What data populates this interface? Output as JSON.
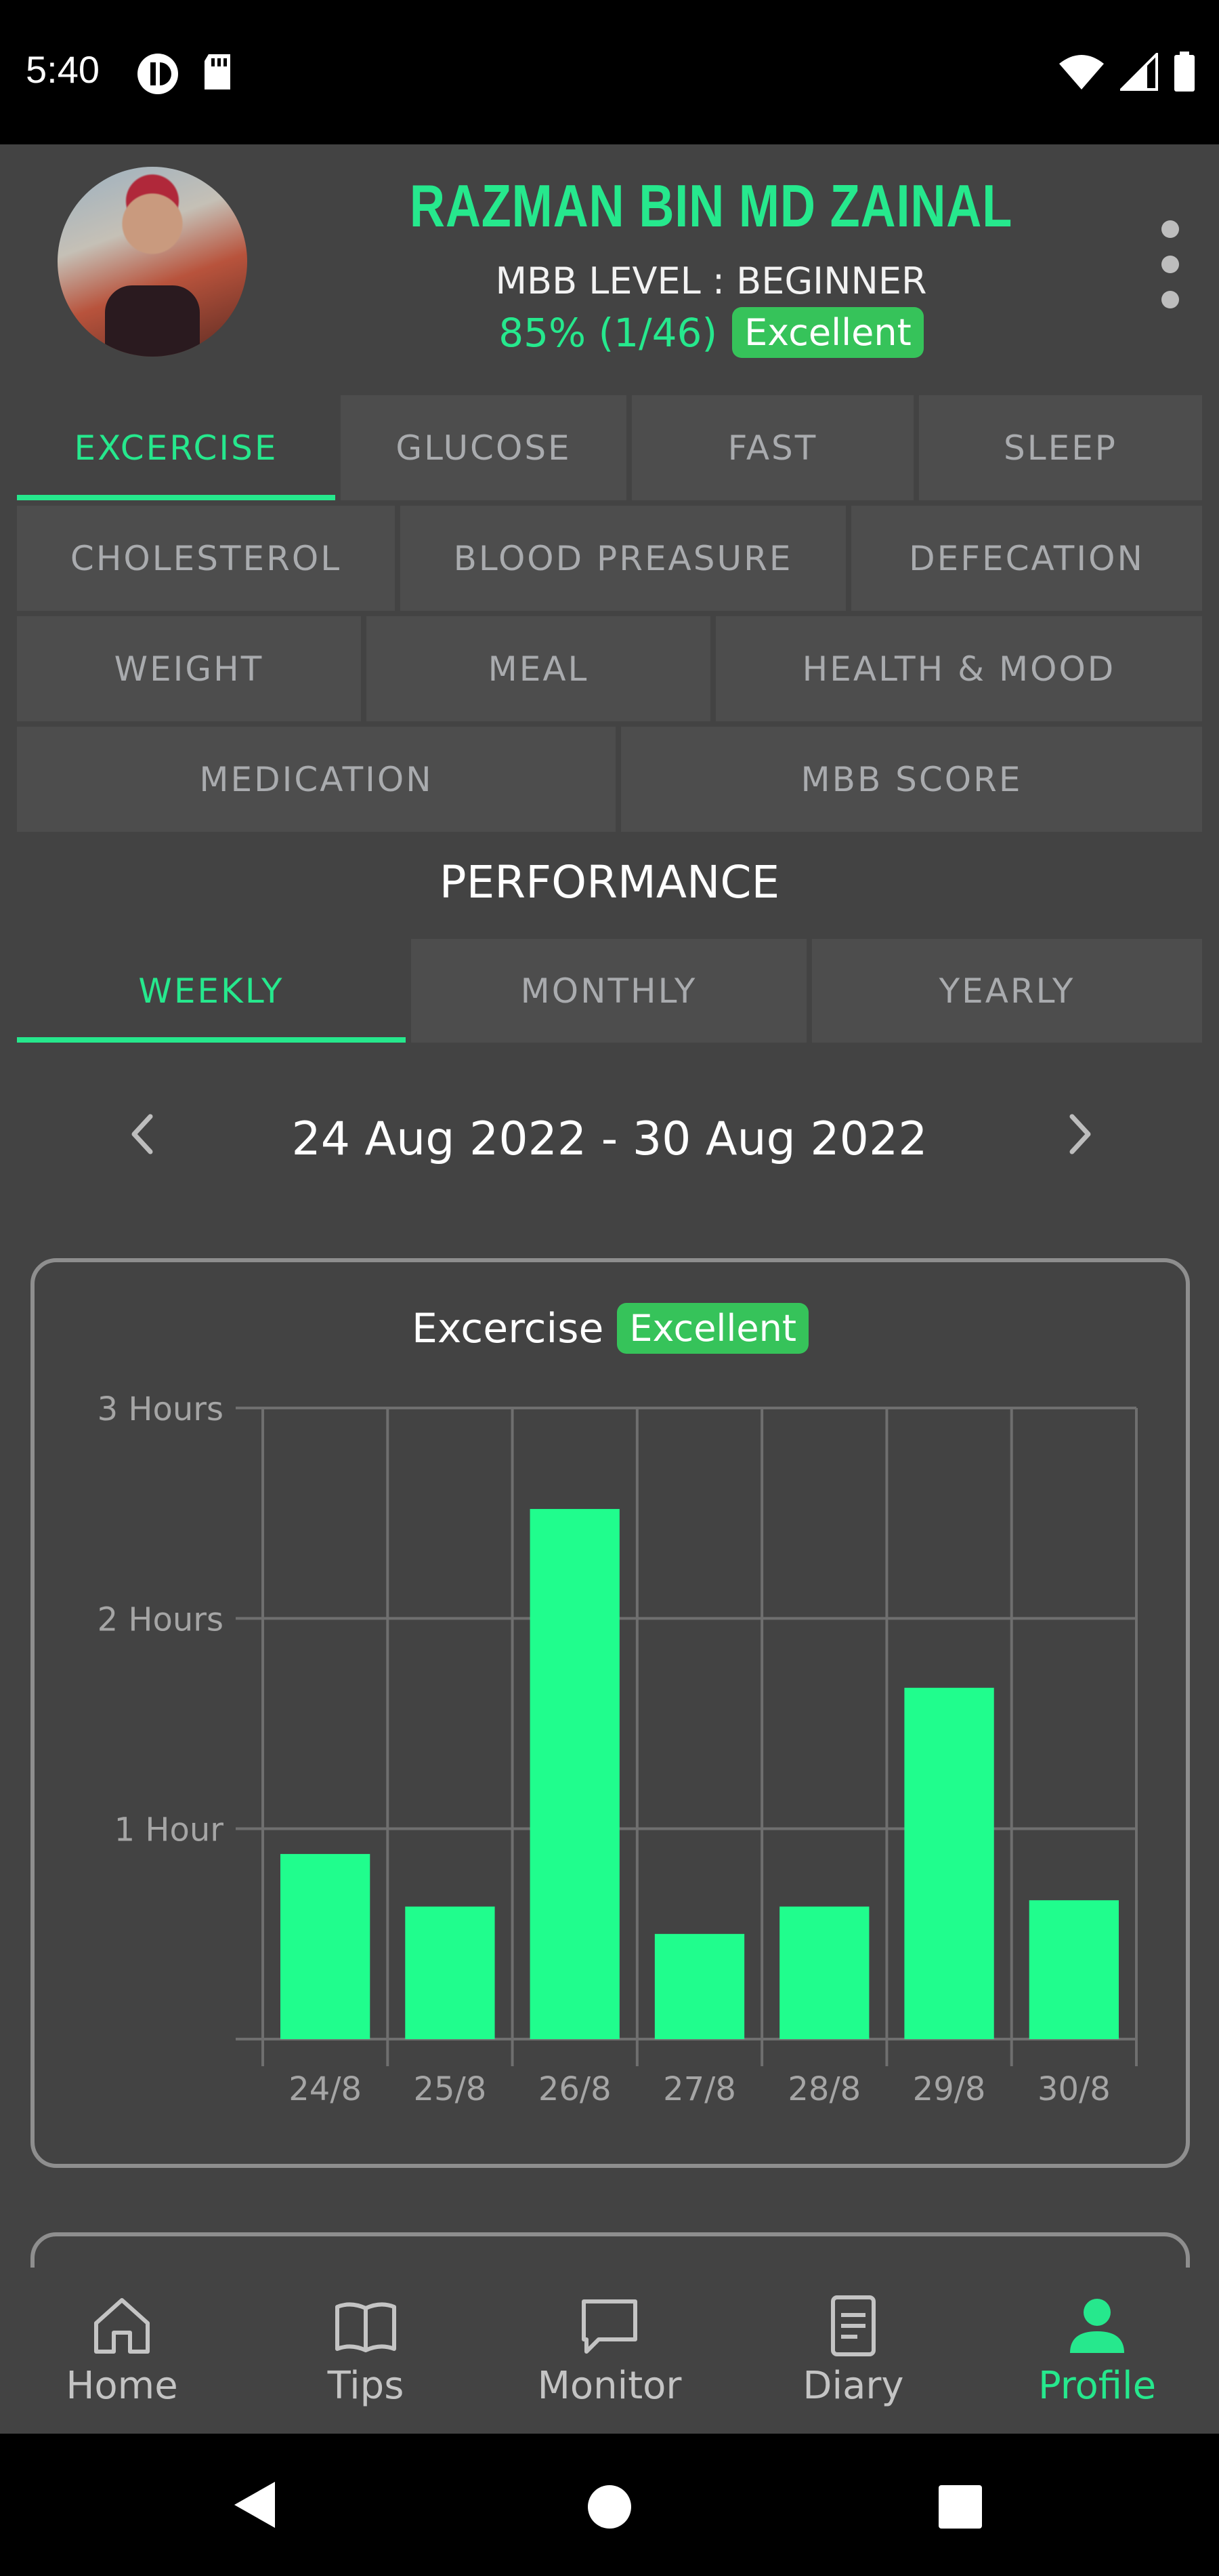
{
  "status_bar": {
    "time": "5:40"
  },
  "profile": {
    "name": "RAZMAN BIN MD ZAINAL",
    "mbb_level": "MBB LEVEL : BEGINNER",
    "score": "85% (1/46)",
    "score_badge": "Excellent"
  },
  "categories": {
    "row1": [
      "EXCERCISE",
      "GLUCOSE",
      "FAST",
      "SLEEP"
    ],
    "row2": [
      "CHOLESTEROL",
      "BLOOD PREASURE",
      "DEFECATION"
    ],
    "row3": [
      "WEIGHT",
      "MEAL",
      "HEALTH & MOOD"
    ],
    "row4": [
      "MEDICATION",
      "MBB SCORE"
    ],
    "active": "EXCERCISE"
  },
  "performance": {
    "title": "PERFORMANCE",
    "periods": [
      "WEEKLY",
      "MONTHLY",
      "YEARLY"
    ],
    "active_period": "WEEKLY",
    "date_range": "24 Aug 2022 - 30 Aug 2022"
  },
  "chart_card": {
    "title": "Excercise",
    "badge": "Excellent"
  },
  "chart_data": {
    "type": "bar",
    "title": "Excercise",
    "categories": [
      "24/8",
      "25/8",
      "26/8",
      "27/8",
      "28/8",
      "29/8",
      "30/8"
    ],
    "values": [
      0.88,
      0.63,
      2.52,
      0.5,
      0.63,
      1.67,
      0.66
    ],
    "y_tick_labels": [
      "1 Hour",
      "2 Hours",
      "3 Hours"
    ],
    "y_ticks": [
      1,
      2,
      3
    ],
    "ylim": [
      0,
      3
    ],
    "bar_color": "#20fd8d",
    "grid": true
  },
  "bottom_nav": {
    "items": [
      {
        "label": "Home",
        "icon": "home-icon"
      },
      {
        "label": "Tips",
        "icon": "book-icon"
      },
      {
        "label": "Monitor",
        "icon": "chat-bubble-icon"
      },
      {
        "label": "Diary",
        "icon": "document-icon"
      },
      {
        "label": "Profile",
        "icon": "person-icon"
      }
    ],
    "active": "Profile"
  },
  "colors": {
    "accent": "#26e88d",
    "badge": "#36c35a",
    "background": "#434343",
    "tab_bg": "#4d4d4d"
  }
}
